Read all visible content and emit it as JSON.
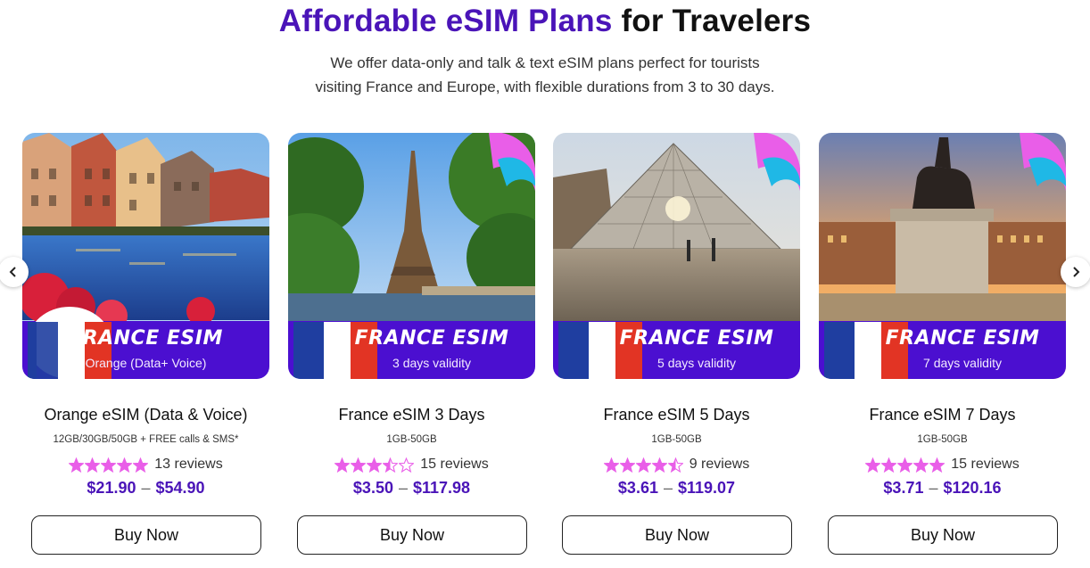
{
  "header": {
    "title_accent": "Affordable eSIM Plans",
    "title_rest": "for Travelers",
    "subtitle_line1": "We offer data-only and talk & text eSIM plans perfect for tourists",
    "subtitle_line2": "visiting France and Europe, with flexible durations from 3 to 30 days."
  },
  "colors": {
    "accent": "#4a14b8",
    "star": "#e95ee8",
    "banner": "#4b0fd0"
  },
  "carousel": {
    "prev_icon": "chevron-left-icon",
    "next_icon": "chevron-right-icon"
  },
  "products": [
    {
      "banner_title": "FRANCE ESIM",
      "banner_sub": "Orange (Data+ Voice)",
      "name": "Orange eSIM (Data & Voice)",
      "detail": "12GB/30GB/50GB + FREE calls & SMS*",
      "rating": 5,
      "reviews": "13 reviews",
      "price_min": "$21.90",
      "price_max": "$54.90",
      "buy": "Buy Now"
    },
    {
      "banner_title": "FRANCE ESIM",
      "banner_sub": "3 days validity",
      "name": "France eSIM 3 Days",
      "detail": "1GB-50GB",
      "rating": 3.5,
      "reviews": "15 reviews",
      "price_min": "$3.50",
      "price_max": "$117.98",
      "buy": "Buy Now"
    },
    {
      "banner_title": "FRANCE ESIM",
      "banner_sub": "5 days validity",
      "name": "France eSIM 5 Days",
      "detail": "1GB-50GB",
      "rating": 4.5,
      "reviews": "9 reviews",
      "price_min": "$3.61",
      "price_max": "$119.07",
      "buy": "Buy Now"
    },
    {
      "banner_title": "FRANCE ESIM",
      "banner_sub": "7 days validity",
      "name": "France eSIM 7 Days",
      "detail": "1GB-50GB",
      "rating": 5,
      "reviews": "15 reviews",
      "price_min": "$3.71",
      "price_max": "$120.16",
      "buy": "Buy Now"
    }
  ]
}
